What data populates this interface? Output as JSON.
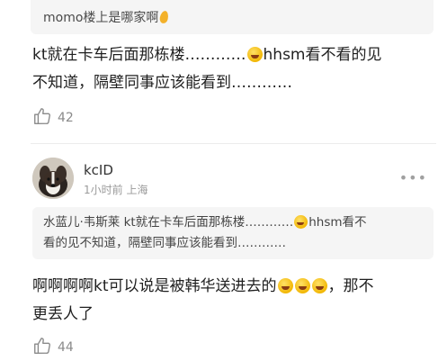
{
  "parent_quote": {
    "text": "momo楼上是哪家啊"
  },
  "first_comment": {
    "line1_before_emoji": "kt就在卡车后面那栋楼…………",
    "line1_after_emoji": "hhsm看不看的见",
    "line2": "不知道，隔壁同事应该能看到…………",
    "likes": "42"
  },
  "second_comment": {
    "username": "kcID",
    "meta": "1小时前 上海",
    "quote_before_emoji": "水蓝儿·韦斯莱 kt就在卡车后面那栋楼…………",
    "quote_after_emoji": "hhsm看不",
    "quote_line2": "看的见不知道，隔壁同事应该能看到…………",
    "line1_before_emoji": "啊啊啊啊kt可以说是被韩华送进去的",
    "line1_after_emoji": "，那不",
    "line2": "更丢人了",
    "likes": "44"
  },
  "icons": {
    "emoji": "laughing-tears-emoji",
    "like": "thumbs-up-icon",
    "more": "more-dots-icon"
  }
}
